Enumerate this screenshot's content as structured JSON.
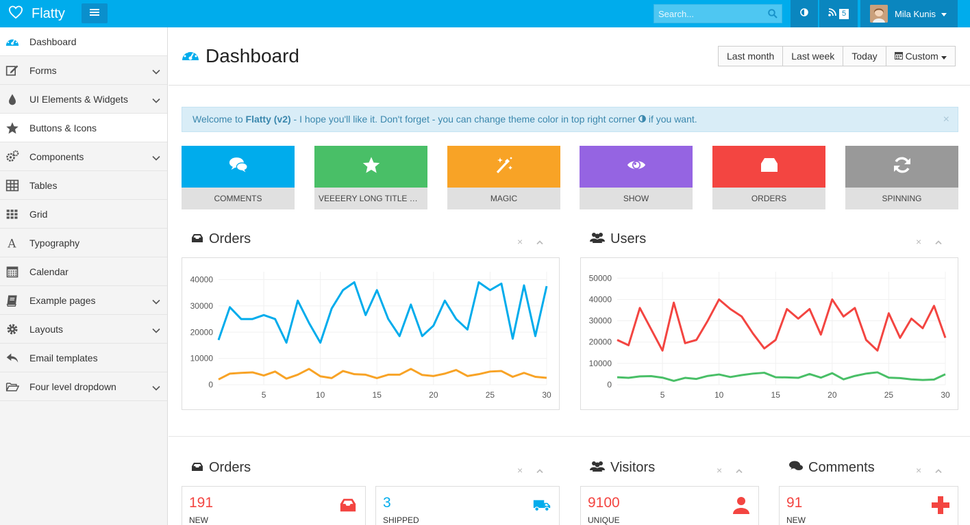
{
  "app": {
    "name": "Flatty"
  },
  "topbar": {
    "search_placeholder": "Search...",
    "rss_count": "5",
    "user_name": "Mila Kunis"
  },
  "sidebar": {
    "items": [
      {
        "label": "Dashboard",
        "icon": "dashboard-icon",
        "has_sub": false,
        "active": true
      },
      {
        "label": "Forms",
        "icon": "edit-icon",
        "has_sub": true
      },
      {
        "label": "UI Elements & Widgets",
        "icon": "tint-icon",
        "has_sub": true
      },
      {
        "label": "Buttons & Icons",
        "icon": "star-icon",
        "has_sub": false,
        "active": true
      },
      {
        "label": "Components",
        "icon": "cogs-icon",
        "has_sub": true
      },
      {
        "label": "Tables",
        "icon": "table-icon",
        "has_sub": false
      },
      {
        "label": "Grid",
        "icon": "grid-icon",
        "has_sub": false
      },
      {
        "label": "Typography",
        "icon": "font-icon",
        "has_sub": false
      },
      {
        "label": "Calendar",
        "icon": "calendar-icon",
        "has_sub": false
      },
      {
        "label": "Example pages",
        "icon": "book-icon",
        "has_sub": true
      },
      {
        "label": "Layouts",
        "icon": "gear-icon",
        "has_sub": true
      },
      {
        "label": "Email templates",
        "icon": "reply-icon",
        "has_sub": false
      },
      {
        "label": "Four level dropdown",
        "icon": "folder-open-icon",
        "has_sub": true
      }
    ]
  },
  "page": {
    "title": "Dashboard"
  },
  "range": {
    "last_month": "Last month",
    "last_week": "Last week",
    "today": "Today",
    "custom": "Custom"
  },
  "alert": {
    "welcome": "Welcome to ",
    "brand": "Flatty (v2)",
    "message": " - I hope you'll like it. Don't forget - you can change theme color in top right corner ",
    "suffix": " if you want.",
    "close": "×"
  },
  "tiles": [
    {
      "label": "COMMENTS",
      "color": "#00acec",
      "icon": "comments-icon"
    },
    {
      "label": "VEEEERY LONG TITLE OF THE BOX",
      "color": "#49bf67",
      "icon": "star-icon"
    },
    {
      "label": "MAGIC",
      "color": "#f8a326",
      "icon": "magic-icon"
    },
    {
      "label": "SHOW",
      "color": "#9564e2",
      "icon": "eye-icon"
    },
    {
      "label": "ORDERS",
      "color": "#f34541",
      "icon": "inbox-icon"
    },
    {
      "label": "SPINNING",
      "color": "#999999",
      "icon": "refresh-icon"
    }
  ],
  "boxes": {
    "orders_chart_title": "Orders",
    "users_chart_title": "Users",
    "orders_title": "Orders",
    "visitors_title": "Visitors",
    "comments_title": "Comments",
    "close": "×"
  },
  "stats": [
    {
      "value": "191",
      "caption": "NEW",
      "color": "#f34541",
      "icon": "inbox-icon"
    },
    {
      "value": "3",
      "caption": "SHIPPED",
      "color": "#00acec",
      "icon": "truck-icon"
    },
    {
      "value": "9100",
      "caption": "UNIQUE",
      "color": "#f34541",
      "icon": "user-icon"
    },
    {
      "value": "91",
      "caption": "NEW",
      "color": "#f34541",
      "icon": "plus-icon"
    }
  ],
  "chart_data": [
    {
      "type": "line",
      "x": [
        1,
        2,
        3,
        4,
        5,
        6,
        7,
        8,
        9,
        10,
        11,
        12,
        13,
        14,
        15,
        16,
        17,
        18,
        19,
        20,
        21,
        22,
        23,
        24,
        25,
        26,
        27,
        28,
        29,
        30
      ],
      "xticks": [
        5,
        10,
        15,
        20,
        25,
        30
      ],
      "yticks": [
        0,
        10000,
        20000,
        30000,
        40000
      ],
      "ylim": [
        0,
        43000
      ],
      "grid": true,
      "series": [
        {
          "color": "#00acec",
          "values": [
            17000,
            29500,
            25000,
            25000,
            26500,
            25000,
            16000,
            32000,
            23500,
            16000,
            29000,
            36000,
            39000,
            26500,
            36000,
            25000,
            18500,
            30500,
            18500,
            22500,
            32000,
            25000,
            21000,
            39000,
            36000,
            38500,
            17500,
            37800,
            18500,
            37500
          ]
        },
        {
          "color": "#f8a326",
          "values": [
            2000,
            4200,
            4500,
            4700,
            3500,
            5000,
            2300,
            3800,
            6000,
            3200,
            2500,
            5200,
            4000,
            3800,
            2500,
            3800,
            3800,
            6000,
            3700,
            3300,
            4200,
            5600,
            3300,
            4000,
            5000,
            5200,
            3000,
            4500,
            3000,
            2600
          ]
        }
      ]
    },
    {
      "type": "line",
      "x": [
        1,
        2,
        3,
        4,
        5,
        6,
        7,
        8,
        9,
        10,
        11,
        12,
        13,
        14,
        15,
        16,
        17,
        18,
        19,
        20,
        21,
        22,
        23,
        24,
        25,
        26,
        27,
        28,
        29,
        30
      ],
      "xticks": [
        5,
        10,
        15,
        20,
        25,
        30
      ],
      "yticks": [
        0,
        10000,
        20000,
        30000,
        40000,
        50000
      ],
      "ylim": [
        0,
        53000
      ],
      "grid": true,
      "series": [
        {
          "color": "#f34541",
          "values": [
            21000,
            18500,
            36000,
            26000,
            16000,
            38500,
            19500,
            21000,
            30000,
            40000,
            35500,
            32000,
            24000,
            17000,
            21000,
            35500,
            31000,
            35500,
            23500,
            40000,
            32000,
            36000,
            21000,
            16000,
            33500,
            22000,
            31000,
            26500,
            37000,
            22000
          ]
        },
        {
          "color": "#49bf67",
          "values": [
            3500,
            3200,
            3900,
            4000,
            3300,
            1800,
            3200,
            2700,
            4100,
            4800,
            3600,
            4500,
            5200,
            5600,
            3500,
            3400,
            3200,
            5000,
            3300,
            5400,
            2500,
            4100,
            5200,
            5800,
            3300,
            3100,
            2500,
            2200,
            2400,
            4900
          ]
        }
      ]
    }
  ]
}
